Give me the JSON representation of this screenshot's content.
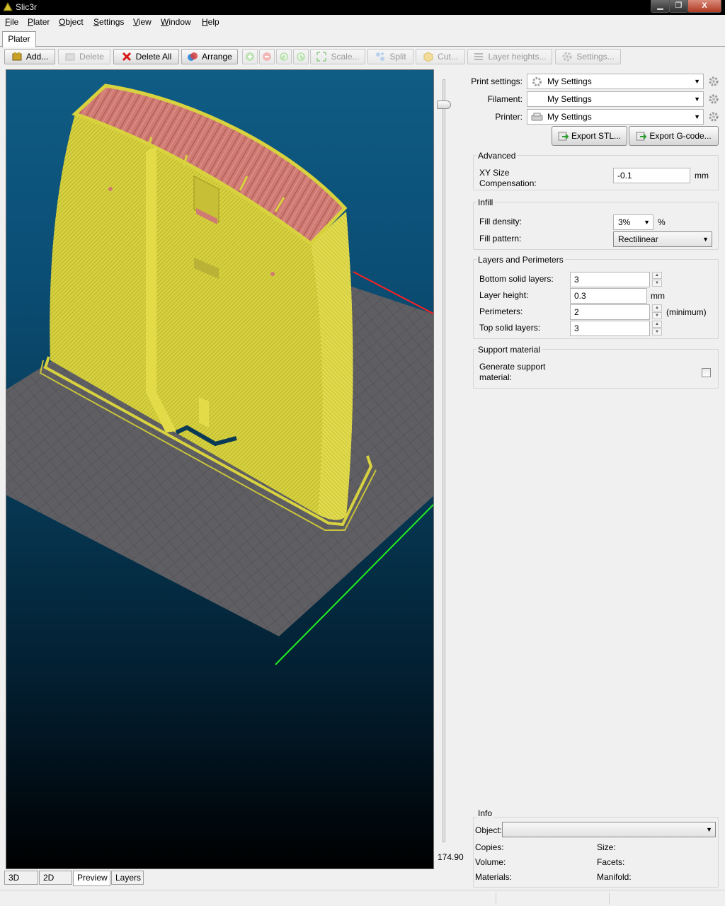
{
  "window": {
    "title": "Slic3r"
  },
  "menu": [
    {
      "u": "F",
      "rest": "ile"
    },
    {
      "u": "P",
      "rest": "later"
    },
    {
      "u": "O",
      "rest": "bject"
    },
    {
      "u": "S",
      "rest": "ettings"
    },
    {
      "u": "V",
      "rest": "iew"
    },
    {
      "u": "W",
      "rest": "indow"
    },
    {
      "u": "H",
      "rest": "elp"
    }
  ],
  "tabs": {
    "plater": "Plater"
  },
  "toolbar": {
    "add": "Add...",
    "delete": "Delete",
    "delete_all": "Delete All",
    "arrange": "Arrange",
    "scale": "Scale...",
    "split": "Split",
    "cut": "Cut...",
    "layer_heights": "Layer heights...",
    "settings": "Settings..."
  },
  "viewport": {
    "layer_value": "174.90"
  },
  "view_tabs": {
    "t3d": "3D",
    "t2d": "2D",
    "preview": "Preview",
    "layers": "Layers"
  },
  "presets": {
    "print_label": "Print settings:",
    "print_value": "My Settings",
    "filament_label": "Filament:",
    "filament_value": "My Settings",
    "printer_label": "Printer:",
    "printer_value": "My Settings",
    "export_stl": "Export STL...",
    "export_gcode": "Export G-code..."
  },
  "advanced": {
    "title": "Advanced",
    "xy_label_1": "XY Size",
    "xy_label_2": "Compensation:",
    "xy_value": "-0.1",
    "xy_unit": "mm"
  },
  "infill": {
    "title": "Infill",
    "density_label": "Fill density:",
    "density_value": "3%",
    "density_unit": "%",
    "pattern_label": "Fill pattern:",
    "pattern_value": "Rectilinear"
  },
  "layers": {
    "title": "Layers and Perimeters",
    "bottom_label": "Bottom solid layers:",
    "bottom_value": "3",
    "height_label": "Layer height:",
    "height_value": "0.3",
    "height_unit": "mm",
    "perimeters_label": "Perimeters:",
    "perimeters_value": "2",
    "perimeters_unit": "(minimum)",
    "top_label": "Top solid layers:",
    "top_value": "3"
  },
  "support": {
    "title": "Support material",
    "gen_label_1": "Generate support",
    "gen_label_2": "material:"
  },
  "info": {
    "title": "Info",
    "object_label": "Object:",
    "copies_label": "Copies:",
    "size_label": "Size:",
    "volume_label": "Volume:",
    "facets_label": "Facets:",
    "materials_label": "Materials:",
    "manifold_label": "Manifold:"
  },
  "colors": {
    "model_yellow": "#d8d23f",
    "model_top_pink": "#cf7a72",
    "bed_gray": "#5f5f63",
    "axis_x": "#ff2020",
    "axis_y": "#22ee22"
  }
}
